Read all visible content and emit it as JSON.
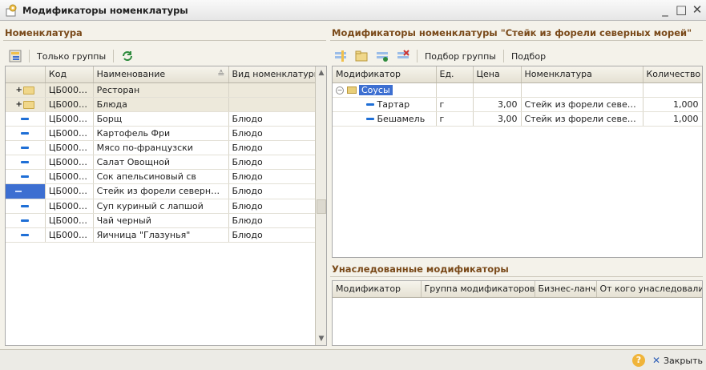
{
  "window": {
    "title": "Модификаторы номенклатуры",
    "icon": "gear-form-icon",
    "buttons": {
      "minimize": "_",
      "maximize": "□",
      "close": "✕"
    }
  },
  "left": {
    "title": "Номенклатура",
    "toolbar": {
      "only_groups": "Только группы"
    },
    "columns": [
      "",
      "Код",
      "Наименование",
      "Вид номенклатуры"
    ],
    "rows": [
      {
        "type": "group",
        "code": "ЦБ0000...",
        "name": "Ресторан",
        "kind": ""
      },
      {
        "type": "group",
        "code": "ЦБ0000...",
        "name": "Блюда",
        "kind": ""
      },
      {
        "type": "item",
        "code": "ЦБ0000...",
        "name": "Борщ",
        "kind": "Блюдо"
      },
      {
        "type": "item",
        "code": "ЦБ0000...",
        "name": "Картофель Фри",
        "kind": "Блюдо"
      },
      {
        "type": "item",
        "code": "ЦБ0000...",
        "name": "Мясо по-французски",
        "kind": "Блюдо"
      },
      {
        "type": "item",
        "code": "ЦБ0000...",
        "name": "Салат Овощной",
        "kind": "Блюдо"
      },
      {
        "type": "item",
        "code": "ЦБ0000...",
        "name": "Сок апельсиновый св",
        "kind": "Блюдо"
      },
      {
        "type": "selected",
        "code": "ЦБ0000...",
        "name": "Стейк из форели северных...",
        "kind": "Блюдо"
      },
      {
        "type": "item",
        "code": "ЦБ0000...",
        "name": "Суп куриный с лапшой",
        "kind": "Блюдо"
      },
      {
        "type": "item",
        "code": "ЦБ0000...",
        "name": "Чай черный",
        "kind": "Блюдо"
      },
      {
        "type": "item",
        "code": "ЦБ0000...",
        "name": "Яичница \"Глазунья\"",
        "kind": "Блюдо"
      }
    ]
  },
  "right": {
    "title": "Модификаторы номенклатуры \"Стейк из форели северных морей\"",
    "toolbar": {
      "pick_groups": "Подбор группы",
      "pick": "Подбор"
    },
    "columns": [
      "Модификатор",
      "Ед.",
      "Цена",
      "Номенклатура",
      "Количество"
    ],
    "group": {
      "name": "Соусы"
    },
    "rows": [
      {
        "name": "Тартар",
        "unit": "г",
        "price": "3,00",
        "item": "Стейк из форели северн...",
        "qty": "1,000"
      },
      {
        "name": "Бешамель",
        "unit": "г",
        "price": "3,00",
        "item": "Стейк из форели северн...",
        "qty": "1,000"
      }
    ]
  },
  "inherited": {
    "title": "Унаследованные модификаторы",
    "columns": [
      "Модификатор",
      "Группа модификаторов",
      "Бизнес-ланч",
      "От кого унаследовали"
    ]
  },
  "status": {
    "close_label": "Закрыть",
    "help": "?"
  },
  "colors": {
    "accent_title": "#7a4a1a",
    "selection": "#3d6fd1",
    "item_marker": "#1f6fd6"
  }
}
